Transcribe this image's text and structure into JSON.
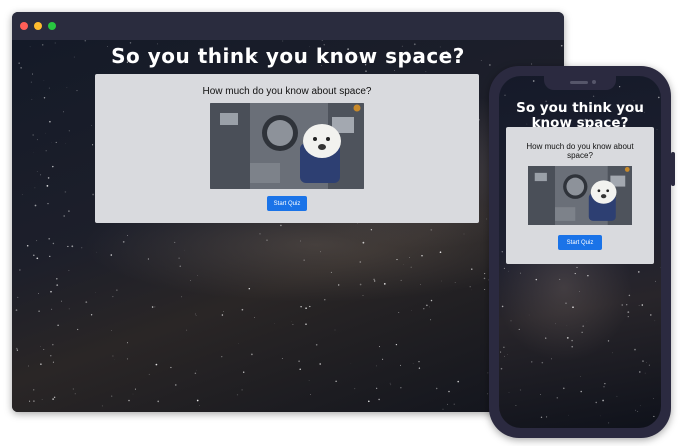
{
  "desktop": {
    "window_controls": {
      "close_color": "#ff5f57",
      "minimize_color": "#febc2e",
      "maximize_color": "#28c840"
    },
    "title": "So you think you know space?",
    "card": {
      "question": "How much do you know about space?",
      "image_icon": "astronaut-dog-photo",
      "start_label": "Start Quiz"
    }
  },
  "mobile": {
    "title": "So you think you know space?",
    "card": {
      "question": "How much do you know about space?",
      "image_icon": "astronaut-dog-photo",
      "start_label": "Start Quiz"
    }
  },
  "colors": {
    "accent": "#1a73e8",
    "card": "#d9dade",
    "frame": "#2b2a40"
  }
}
